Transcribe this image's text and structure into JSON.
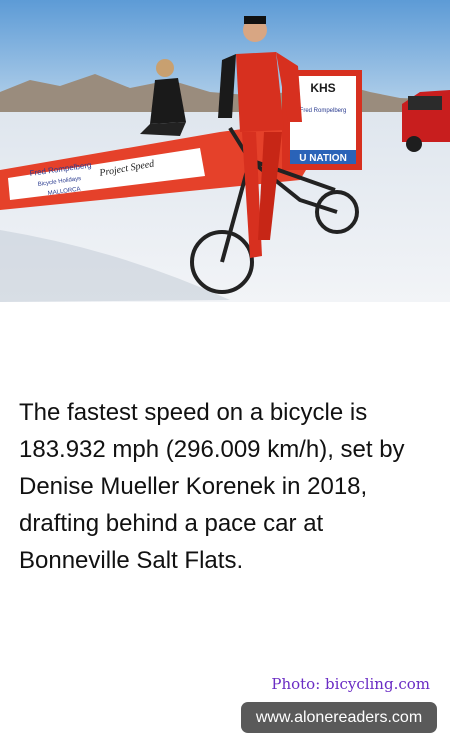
{
  "photo": {
    "sign_banner": "KHS",
    "sign_sponsor": "Fred Rompelberg",
    "sign_footer": "U NATION",
    "car_brand": "Fred Rompelberg",
    "car_sub1": "Bicycle Holidays",
    "car_sub2": "MALLORCA",
    "car_logo": "Project Speed"
  },
  "fact_text": "The fastest speed on a bicycle is 183.932 mph (296.009 km/h), set by Denise Mueller Korenek in 2018, drafting behind a pace car at Bonneville Salt Flats.",
  "credit": "Photo: bicycling.com",
  "site": "www.alonereaders.com"
}
